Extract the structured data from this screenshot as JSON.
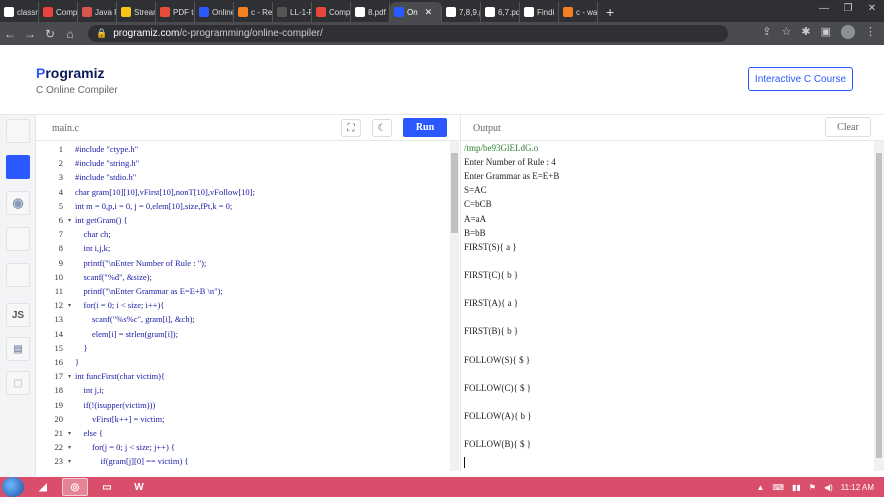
{
  "browser": {
    "tabs": [
      {
        "label": "classro",
        "color": "#ffffff"
      },
      {
        "label": "Comp",
        "color": "#e8453c"
      },
      {
        "label": "Java P",
        "color": "#d9534f"
      },
      {
        "label": "Stream",
        "color": "#f5c518"
      },
      {
        "label": "PDF to",
        "color": "#e74c3c"
      },
      {
        "label": "Online",
        "color": "#2b59ff"
      },
      {
        "label": "c - Rec",
        "color": "#f48024"
      },
      {
        "label": "LL-1-P",
        "color": "#555555"
      },
      {
        "label": "Comp",
        "color": "#e8453c"
      },
      {
        "label": "8.pdf",
        "color": "#ffffff"
      },
      {
        "label": "On",
        "color": "#2b59ff",
        "active": true
      },
      {
        "label": "7,8,9.p",
        "color": "#ffffff"
      },
      {
        "label": "6,7.pdf",
        "color": "#ffffff"
      },
      {
        "label": "Findi",
        "color": "#ffffff"
      },
      {
        "label": "c - war",
        "color": "#f48024"
      }
    ],
    "tab_close": "✕",
    "new_tab": "+",
    "url_host": "programiz.com",
    "url_path": "/c-programming/online-compiler/"
  },
  "site": {
    "logo_p": "P",
    "logo_rest": "rogramiz",
    "subtitle": "C Online Compiler",
    "cta": "Interactive C Course"
  },
  "rail": {
    "js_label": "JS"
  },
  "editor": {
    "file_tab": "main.c",
    "run_label": "Run",
    "lines": [
      {
        "n": "1",
        "fold": "",
        "text": "#include \"ctype.h\""
      },
      {
        "n": "2",
        "fold": "",
        "text": "#include \"string.h\""
      },
      {
        "n": "3",
        "fold": "",
        "text": "#include \"stdio.h\""
      },
      {
        "n": "4",
        "fold": "",
        "text": "char gram[10][10],vFirst[10],nonT[10],vFollow[10];"
      },
      {
        "n": "5",
        "fold": "",
        "text": "int m = 0,p,i = 0, j = 0,elem[10],size,fPt,k = 0;"
      },
      {
        "n": "6",
        "fold": "▾",
        "text": "int getGram() {"
      },
      {
        "n": "7",
        "fold": "",
        "text": "    char ch;"
      },
      {
        "n": "8",
        "fold": "",
        "text": "    int i,j,k;"
      },
      {
        "n": "9",
        "fold": "",
        "text": "    printf(\"\\nEnter Number of Rule : \");"
      },
      {
        "n": "10",
        "fold": "",
        "text": "    scanf(\"%d\", &size);"
      },
      {
        "n": "11",
        "fold": "",
        "text": "    printf(\"\\nEnter Grammar as E=E+B \\n\");"
      },
      {
        "n": "12",
        "fold": "▾",
        "text": "    for(i = 0; i < size; i++){"
      },
      {
        "n": "13",
        "fold": "",
        "text": "        scanf(\"%s%c\", gram[i], &ch);"
      },
      {
        "n": "14",
        "fold": "",
        "text": "        elem[i] = strlen(gram[i]);"
      },
      {
        "n": "15",
        "fold": "",
        "text": "    }"
      },
      {
        "n": "16",
        "fold": "",
        "text": "}"
      },
      {
        "n": "17",
        "fold": "▾",
        "text": "int funcFirst(char victim){"
      },
      {
        "n": "18",
        "fold": "",
        "text": "    int j,i;"
      },
      {
        "n": "19",
        "fold": "",
        "text": "    if(!(isupper(victim)))"
      },
      {
        "n": "20",
        "fold": "",
        "text": "        vFirst[k++] = victim;"
      },
      {
        "n": "21",
        "fold": "▾",
        "text": "    else {"
      },
      {
        "n": "22",
        "fold": "▾",
        "text": "        for(j = 0; j < size; j++) {"
      },
      {
        "n": "23",
        "fold": "▾",
        "text": "            if(gram[j][0] == victim) {"
      }
    ]
  },
  "output": {
    "title": "Output",
    "clear_label": "Clear",
    "lines": [
      "/tmp/be93GlELdG.o",
      "Enter Number of Rule : 4",
      "Enter Grammar as E=E+B",
      "S=AC",
      "C=bCB",
      "A=aA",
      "B=bB",
      "FIRST(S){ a }",
      "",
      "FIRST(C){ b }",
      "",
      "FIRST(A){ a }",
      "",
      "FIRST(B){ b }",
      "",
      "FOLLOW(S){ $ }",
      "",
      "FOLLOW(C){ $ }",
      "",
      "FOLLOW(A){ b }",
      "",
      "FOLLOW(B){ $ }"
    ]
  },
  "taskbar": {
    "word_label": "W",
    "clock": "11:12 AM"
  }
}
